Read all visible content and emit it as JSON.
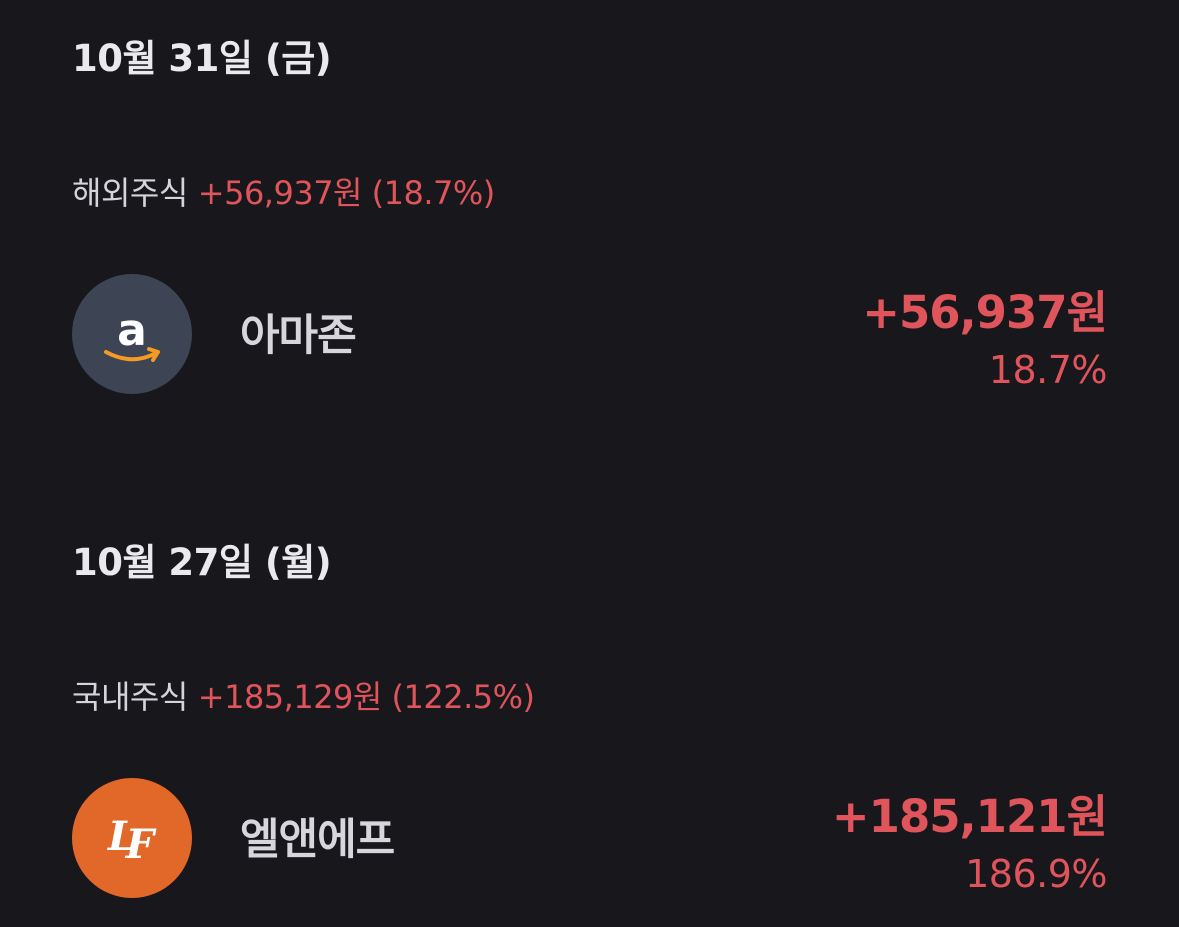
{
  "colors": {
    "background": "#17171c",
    "gain_red": "#e0545c",
    "amazon_logo_bg": "#3d4554",
    "lf_logo_bg": "#e2682a"
  },
  "groups": [
    {
      "date": "10월 31일 (금)",
      "category": "해외주식",
      "category_gain": "+56,937원 (18.7%)",
      "stock": {
        "name": "아마존",
        "icon": "amazon-logo-icon",
        "amount": "+56,937원",
        "percent": "18.7%"
      }
    },
    {
      "date": "10월 27일 (월)",
      "category": "국내주식",
      "category_gain": "+185,129원 (122.5%)",
      "stock": {
        "name": "엘앤에프",
        "icon": "lf-logo-icon",
        "amount": "+185,121원",
        "percent": "186.9%"
      }
    }
  ]
}
